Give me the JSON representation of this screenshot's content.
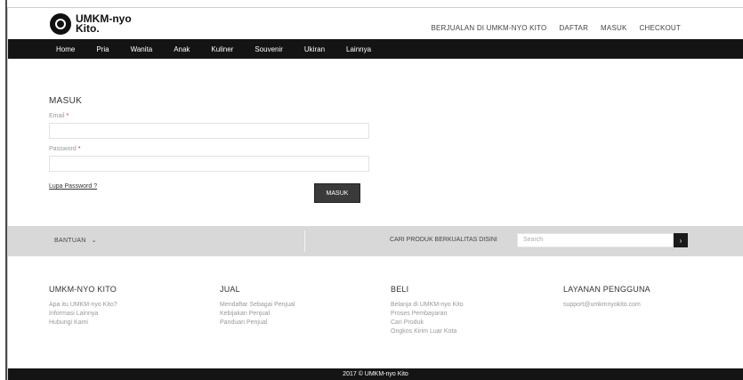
{
  "brand": {
    "name": "UMKM-nyo Kito.",
    "name_line1": "UMKM-nyo",
    "name_line2": "Kito."
  },
  "top_nav": [
    "BERJUALAN DI UMKM-NYO KITO",
    "DAFTAR",
    "MASUK",
    "CHECKOUT"
  ],
  "categories": [
    "Home",
    "Pria",
    "Wanita",
    "Anak",
    "Kuliner",
    "Souvenir",
    "Ukiran",
    "Lainnya"
  ],
  "login": {
    "title": "MASUK",
    "email_label": "Email",
    "password_label": "Password",
    "required_mark": "*",
    "email_value": "",
    "password_value": "",
    "forgot_label": "Lupa Password ?",
    "submit_label": "MASUK"
  },
  "help_bar": {
    "help_label": "BANTUAN",
    "cta": "CARI PRODUK BERKUALITAS DISINI",
    "search_placeholder": "Search",
    "search_button": "›"
  },
  "footer_columns": [
    {
      "title": "UMKM-NYO KITO",
      "items": [
        "Apa itu UMKM-nyo Kito?",
        "Informasi Lainnya",
        "Hubungi Kami"
      ]
    },
    {
      "title": "JUAL",
      "items": [
        "Mendaftar Sebagai Penjual",
        "Kebijakan Penjual",
        "Panduan Penjual"
      ]
    },
    {
      "title": "BELI",
      "items": [
        "Belanja di UMKM-nyo Kito",
        "Proses Pembayaran",
        "Cari Produk",
        "Ongkos Kirim Luar Kota"
      ]
    },
    {
      "title": "LAYANAN PENGGUNA",
      "items": [
        "support@umkmnyokito.com"
      ]
    }
  ],
  "copyright": "2017 © UMKM-nyo Kito"
}
